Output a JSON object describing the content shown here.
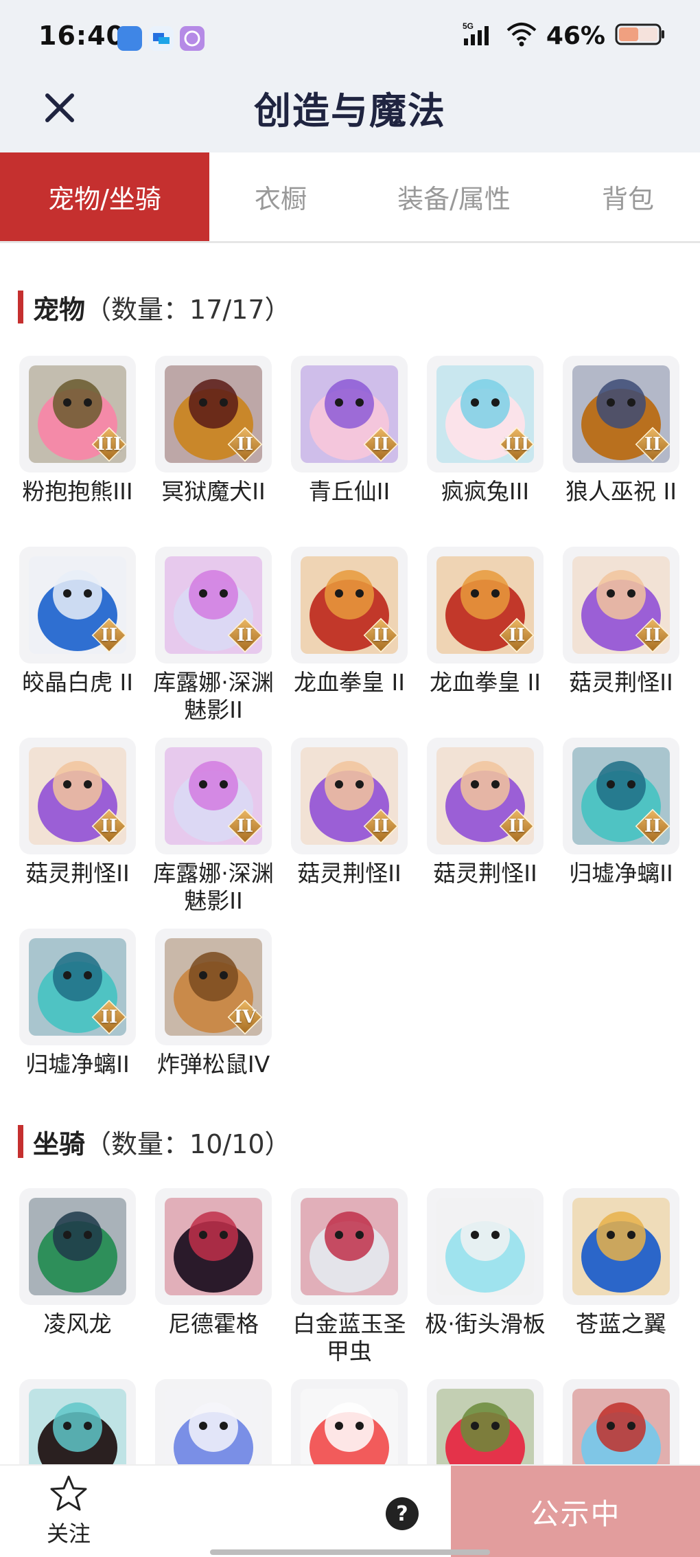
{
  "status_bar": {
    "time": "16:40",
    "network": "5G",
    "battery_text": "46%",
    "app_icons": [
      "blue-app-icon",
      "chat-app-icon",
      "purple-app-icon"
    ]
  },
  "header": {
    "title": "创造与魔法",
    "close_icon": "close-icon"
  },
  "tabs": [
    {
      "label": "宠物/坐骑",
      "active": true
    },
    {
      "label": "衣橱",
      "active": false
    },
    {
      "label": "装备/属性",
      "active": false
    },
    {
      "label": "背包",
      "active": false
    }
  ],
  "pets_section": {
    "name": "宠物",
    "count": "（数量：17/17）",
    "items": [
      {
        "name": "粉抱抱熊III",
        "badge": "III",
        "colors": [
          "#f48aa8",
          "#6a5a2e"
        ]
      },
      {
        "name": "冥狱魔犬II",
        "badge": "II",
        "colors": [
          "#c9872a",
          "#5a1b16"
        ]
      },
      {
        "name": "青丘仙II",
        "badge": "II",
        "colors": [
          "#f4c6dc",
          "#8d5bd6"
        ]
      },
      {
        "name": "疯疯兔III",
        "badge": "III",
        "colors": [
          "#fbe3ea",
          "#7bd0e6"
        ]
      },
      {
        "name": "狼人巫祝 II",
        "badge": "II",
        "colors": [
          "#b9701e",
          "#3d4b76"
        ]
      },
      {
        "name": "皎晶白虎 II",
        "badge": "II",
        "colors": [
          "#2f6fd1",
          "#e7eef8"
        ]
      },
      {
        "name": "库露娜·深渊魅影II",
        "badge": "II",
        "colors": [
          "#dcd8f4",
          "#d27be0"
        ]
      },
      {
        "name": "龙血拳皇 II",
        "badge": "II",
        "colors": [
          "#c2382a",
          "#e79a3c"
        ]
      },
      {
        "name": "龙血拳皇 II",
        "badge": "II",
        "colors": [
          "#c2382a",
          "#e79a3c"
        ]
      },
      {
        "name": "菇灵荆怪II",
        "badge": "II",
        "colors": [
          "#9b5fd6",
          "#f2c49c"
        ]
      },
      {
        "name": "菇灵荆怪II",
        "badge": "II",
        "colors": [
          "#9b5fd6",
          "#f2c49c"
        ]
      },
      {
        "name": "库露娜·深渊魅影II",
        "badge": "II",
        "colors": [
          "#dcd8f4",
          "#d27be0"
        ]
      },
      {
        "name": "菇灵荆怪II",
        "badge": "II",
        "colors": [
          "#9b5fd6",
          "#f2c49c"
        ]
      },
      {
        "name": "菇灵荆怪II",
        "badge": "II",
        "colors": [
          "#9b5fd6",
          "#f2c49c"
        ]
      },
      {
        "name": "归墟净螭II",
        "badge": "II",
        "colors": [
          "#4fc3c3",
          "#1f6f86"
        ]
      },
      {
        "name": "归墟净螭II",
        "badge": "II",
        "colors": [
          "#4fc3c3",
          "#1f6f86"
        ]
      },
      {
        "name": "炸弹松鼠IV",
        "badge": "IV",
        "colors": [
          "#c98a4a",
          "#7a4a1e"
        ]
      }
    ]
  },
  "mounts_section": {
    "name": "坐骑",
    "count": "（数量：10/10）",
    "items": [
      {
        "name": "凌风龙",
        "colors": [
          "#2e8f5a",
          "#1f3a4a"
        ]
      },
      {
        "name": "尼德霍格",
        "colors": [
          "#2a1a2a",
          "#c0304a"
        ]
      },
      {
        "name": "白金蓝玉圣甲虫",
        "colors": [
          "#e4e4ea",
          "#c0304a"
        ]
      },
      {
        "name": "极·街头滑板",
        "colors": [
          "#9fe3ee",
          "#f2f2f2"
        ]
      },
      {
        "name": "苍蓝之翼",
        "colors": [
          "#2b66c9",
          "#e8b24a"
        ]
      },
      {
        "name": "",
        "colors": [
          "#2a2020",
          "#5fc7c9"
        ]
      },
      {
        "name": "",
        "colors": [
          "#7a8fe6",
          "#f4f4fa"
        ]
      },
      {
        "name": "",
        "colors": [
          "#f25b5b",
          "#ffffff"
        ]
      },
      {
        "name": "",
        "colors": [
          "#e4334a",
          "#6b8b3a"
        ]
      },
      {
        "name": "",
        "colors": [
          "#7fc6e6",
          "#c0302a"
        ]
      }
    ]
  },
  "bottom_bar": {
    "follow_label": "关注",
    "follow_icon": "star-icon",
    "help_icon": "help-icon",
    "help_glyph": "?",
    "public_label": "公示中"
  }
}
